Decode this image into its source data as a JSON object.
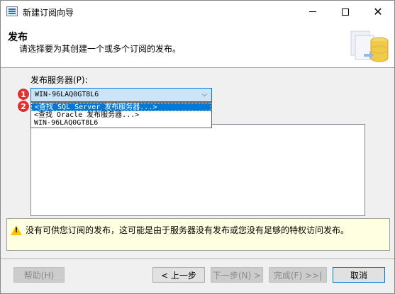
{
  "window": {
    "title": "新建订阅向导"
  },
  "header": {
    "title": "发布",
    "subtitle": "请选择要为其创建一个或多个订阅的发布。"
  },
  "publisher": {
    "label": "发布服务器(P):",
    "selected": "WIN-96LAQ0GT8L6",
    "options": [
      "<查找 SQL Server 发布服务器...>",
      "<查找 Oracle 发布服务器...>",
      "WIN-96LAQ0GT8L6"
    ]
  },
  "badges": [
    "1",
    "2"
  ],
  "warning": {
    "text": "没有可供您订阅的发布，这可能是由于服务器没有发布或您没有足够的特权访问发布。"
  },
  "buttons": {
    "help": "帮助(H)",
    "back": "< 上一步",
    "next": "下一步(N) >",
    "finish": "完成(F) >>|",
    "cancel": "取消"
  },
  "colors": {
    "selection": "#0078d7",
    "badge": "#e03030",
    "warning_bg": "#ffffe1"
  }
}
